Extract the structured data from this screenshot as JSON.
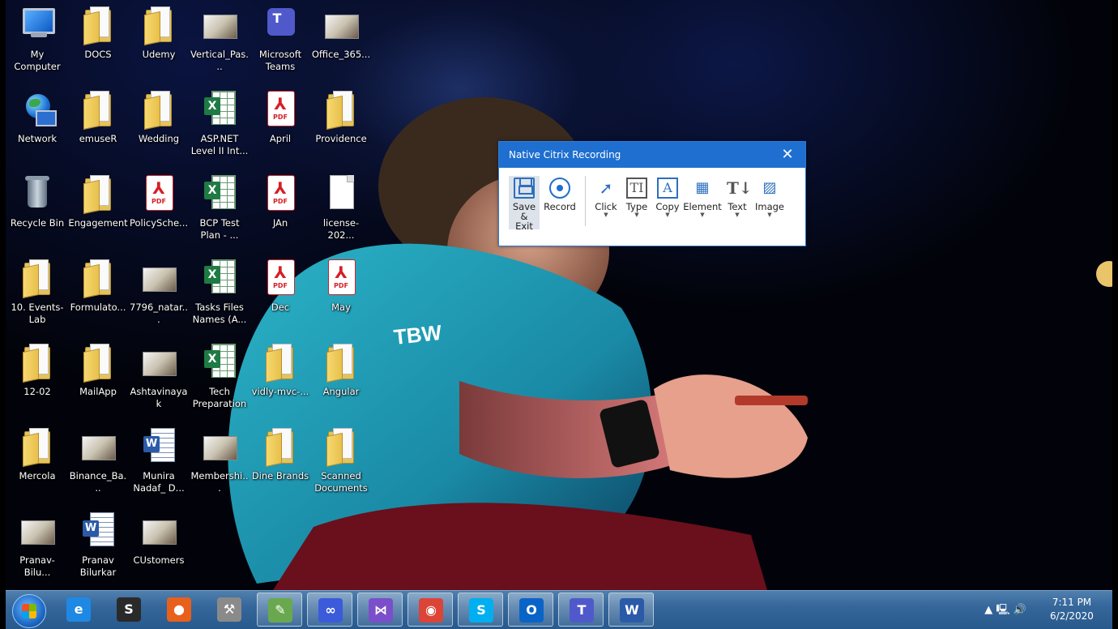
{
  "desktop": {
    "icons": [
      {
        "label": "My Computer",
        "icon": "computer-icon"
      },
      {
        "label": "DOCS",
        "icon": "folder-icon"
      },
      {
        "label": "Udemy",
        "icon": "folder-icon"
      },
      {
        "label": "Vertical_Pas...",
        "icon": "image-thumbnail-icon"
      },
      {
        "label": "Microsoft Teams",
        "icon": "teams-icon"
      },
      {
        "label": "Office_365...",
        "icon": "image-thumbnail-icon"
      },
      {
        "label": "Network",
        "icon": "network-icon"
      },
      {
        "label": "emuseR",
        "icon": "folder-icon"
      },
      {
        "label": "Wedding",
        "icon": "folder-icon"
      },
      {
        "label": "ASP.NET Level II Int...",
        "icon": "excel-icon"
      },
      {
        "label": "April",
        "icon": "pdf-icon"
      },
      {
        "label": "Providence",
        "icon": "folder-icon"
      },
      {
        "label": "Recycle Bin",
        "icon": "recycle-bin-icon"
      },
      {
        "label": "Engagement",
        "icon": "folder-icon"
      },
      {
        "label": "PolicySche...",
        "icon": "pdf-icon"
      },
      {
        "label": "BCP Test Plan - ...",
        "icon": "excel-icon"
      },
      {
        "label": "JAn",
        "icon": "pdf-icon"
      },
      {
        "label": "license-202...",
        "icon": "blank-file-icon"
      },
      {
        "label": "10. Events-Lab",
        "icon": "folder-icon"
      },
      {
        "label": "Formulato...",
        "icon": "folder-icon"
      },
      {
        "label": "7796_natar...",
        "icon": "image-thumbnail-icon"
      },
      {
        "label": "Tasks Files Names (A...",
        "icon": "excel-icon"
      },
      {
        "label": "Dec",
        "icon": "pdf-icon"
      },
      {
        "label": "May",
        "icon": "pdf-icon"
      },
      {
        "label": "12-02",
        "icon": "folder-icon"
      },
      {
        "label": "MailApp",
        "icon": "folder-icon"
      },
      {
        "label": "Ashtavinayak",
        "icon": "image-thumbnail-icon"
      },
      {
        "label": "Tech Preparation",
        "icon": "excel-icon"
      },
      {
        "label": "vidly-mvc-...",
        "icon": "folder-icon"
      },
      {
        "label": "Angular",
        "icon": "folder-icon"
      },
      {
        "label": "Mercola",
        "icon": "folder-icon"
      },
      {
        "label": "Binance_Ba...",
        "icon": "image-thumbnail-icon"
      },
      {
        "label": "Munira Nadaf_ D...",
        "icon": "word-icon"
      },
      {
        "label": "Membershi...",
        "icon": "image-thumbnail-icon"
      },
      {
        "label": "Dine Brands",
        "icon": "folder-icon"
      },
      {
        "label": "Scanned Documents",
        "icon": "folder-icon"
      },
      {
        "label": "Pranav-Bilu...",
        "icon": "image-thumbnail-icon"
      },
      {
        "label": "Pranav Bilurkar",
        "icon": "word-icon"
      },
      {
        "label": "CUstomers",
        "icon": "image-thumbnail-icon"
      }
    ],
    "wallpaper_print": "TBW"
  },
  "recording_dialog": {
    "title": "Native Citrix Recording",
    "close_glyph": "✕",
    "tools": [
      {
        "label": "Save & Exit",
        "icon": "save-icon",
        "has_dropdown": false,
        "selected": true
      },
      {
        "label": "Record",
        "icon": "record-icon",
        "has_dropdown": false,
        "selected": false
      },
      {
        "label": "Click",
        "icon": "click-icon",
        "has_dropdown": true,
        "selected": false
      },
      {
        "label": "Type",
        "icon": "type-icon",
        "has_dropdown": true,
        "selected": false
      },
      {
        "label": "Copy",
        "icon": "copy-icon",
        "has_dropdown": true,
        "selected": false
      },
      {
        "label": "Element",
        "icon": "element-icon",
        "has_dropdown": true,
        "selected": false
      },
      {
        "label": "Text",
        "icon": "text-icon",
        "has_dropdown": true,
        "selected": false
      },
      {
        "label": "Image",
        "icon": "image-icon",
        "has_dropdown": true,
        "selected": false
      }
    ]
  },
  "taskbar": {
    "apps": [
      {
        "name": "internet-explorer-icon",
        "glyph": "e",
        "color": "#1e88e5"
      },
      {
        "name": "sql-server-icon",
        "glyph": "S",
        "color": "#2a2a2a"
      },
      {
        "name": "firefox-icon",
        "glyph": "●",
        "color": "#e8601c"
      },
      {
        "name": "tools-icon",
        "glyph": "⚒",
        "color": "#8a8a8a"
      },
      {
        "name": "notepad-plus-icon",
        "glyph": "✎",
        "color": "#6aa84f"
      },
      {
        "name": "infinity-app-icon",
        "glyph": "∞",
        "color": "#3b5bdb"
      },
      {
        "name": "visual-studio-icon",
        "glyph": "⋈",
        "color": "#7b4fc9"
      },
      {
        "name": "chrome-icon",
        "glyph": "◉",
        "color": "#db4437"
      },
      {
        "name": "skype-icon",
        "glyph": "S",
        "color": "#00aff0"
      },
      {
        "name": "outlook-icon",
        "glyph": "O",
        "color": "#0a64c7"
      },
      {
        "name": "teams-icon",
        "glyph": "T",
        "color": "#5059c9"
      },
      {
        "name": "word-icon",
        "glyph": "W",
        "color": "#2b5aa8"
      }
    ],
    "tray": {
      "icons_glyphs": "▲  🖳 🔊",
      "time": "7:11 PM",
      "date": "6/2/2020"
    }
  }
}
